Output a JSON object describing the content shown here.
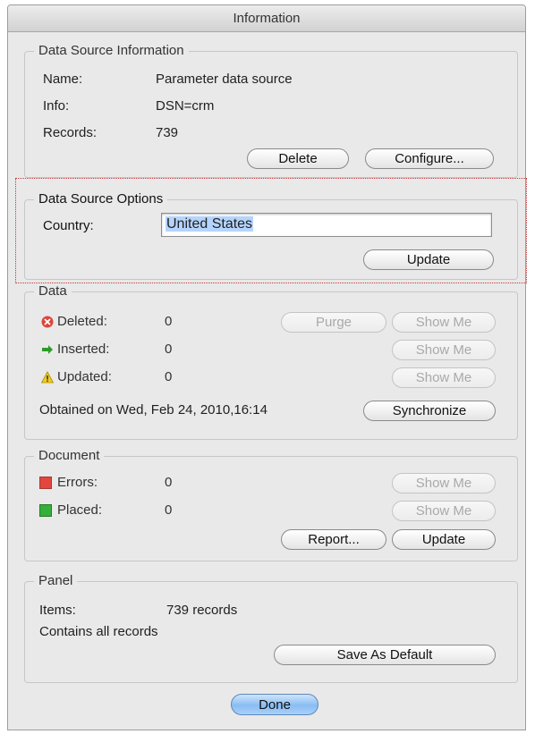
{
  "window": {
    "title": "Information"
  },
  "data_source_information": {
    "legend": "Data Source Information",
    "rows": [
      {
        "label": "Name:",
        "value": "Parameter data source"
      },
      {
        "label": "Info:",
        "value": "DSN=crm"
      },
      {
        "label": "Records:",
        "value": "739"
      }
    ],
    "delete_label": "Delete",
    "configure_label": "Configure..."
  },
  "data_source_options": {
    "legend": "Data Source Options",
    "country_label": "Country:",
    "country_value": "United States",
    "update_label": "Update"
  },
  "data": {
    "legend": "Data",
    "deleted_label": "Deleted:",
    "deleted_value": "0",
    "inserted_label": "Inserted:",
    "inserted_value": "0",
    "updated_label": "Updated:",
    "updated_value": "0",
    "purge_label": "Purge",
    "show_me_label": "Show Me",
    "obtained_text": "Obtained on Wed, Feb 24, 2010,16:14",
    "synchronize_label": "Synchronize"
  },
  "document": {
    "legend": "Document",
    "errors_label": "Errors:",
    "errors_value": "0",
    "placed_label": "Placed:",
    "placed_value": "0",
    "show_me_label": "Show Me",
    "report_label": "Report...",
    "update_label": "Update"
  },
  "panel": {
    "legend": "Panel",
    "items_label": "Items:",
    "items_value": "739 records",
    "contains_text": "Contains all records",
    "save_default_label": "Save As Default"
  },
  "footer": {
    "done_label": "Done"
  },
  "colors": {
    "deleted_icon": "#d9473e",
    "inserted_icon": "#2e9a2a",
    "warning_icon": "#f2cc1c",
    "errors_swatch": "#e2463d",
    "placed_swatch": "#35b03a",
    "focus_ring": "#c03a3a",
    "default_button": "#89bdf3"
  }
}
